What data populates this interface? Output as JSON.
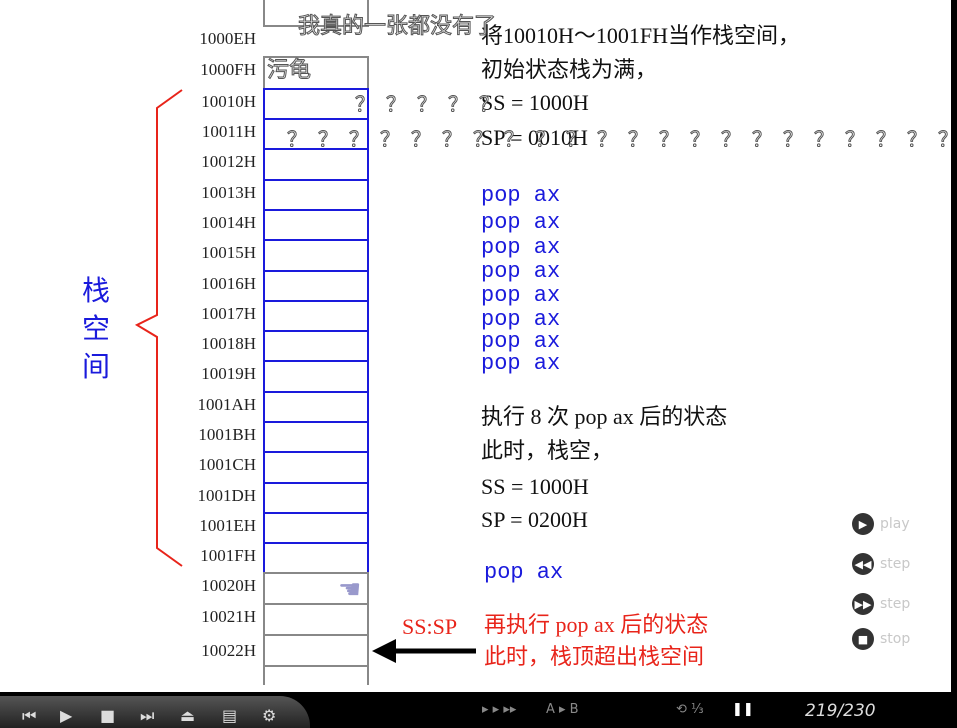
{
  "addresses": [
    "1000EH",
    "1000FH",
    "10010H",
    "10011H",
    "10012H",
    "10013H",
    "10014H",
    "10015H",
    "10016H",
    "10017H",
    "10018H",
    "10019H",
    "1001AH",
    "1001BH",
    "1001CH",
    "1001DH",
    "1001EH",
    "1001FH",
    "10020H",
    "10021H",
    "10022H"
  ],
  "stack_label": "栈空间",
  "text": {
    "line1": "将10010H～1001FH当作栈空间，",
    "line2": "初始状态栈为满，",
    "ss1": "SS = 1000H",
    "sp1": "SP = 0010H",
    "pops": [
      "pop ax",
      "pop ax",
      "pop ax",
      "pop ax",
      "pop ax",
      "pop ax",
      "pop ax",
      "pop ax"
    ],
    "after8": "执行 8 次 pop ax 后的状态",
    "empty": "此时，栈空，",
    "ss2": "SS = 1000H",
    "sp2": "SP = 0200H",
    "pop_again": "pop ax",
    "sssp": "SS:SP",
    "after_again": "再执行 pop ax 后的状态",
    "overflow": "此时，栈顶超出栈空间"
  },
  "subtitles": {
    "line1": "我真的一张都没有了",
    "line2": "污龟",
    "qm1": "？？？？？",
    "qm2": "？？？？？？？？？？？？？？？？？？？？？？"
  },
  "controls": {
    "play": "play",
    "step_back": "step",
    "step_forward": "step",
    "stop": "stop"
  },
  "player": {
    "speed_label": "▸ ▸ ▸▸",
    "ab_label": "A ▸ B",
    "page": "219/230"
  },
  "colors": {
    "accent_blue": "#1a1adc",
    "accent_red": "#e8241a"
  }
}
